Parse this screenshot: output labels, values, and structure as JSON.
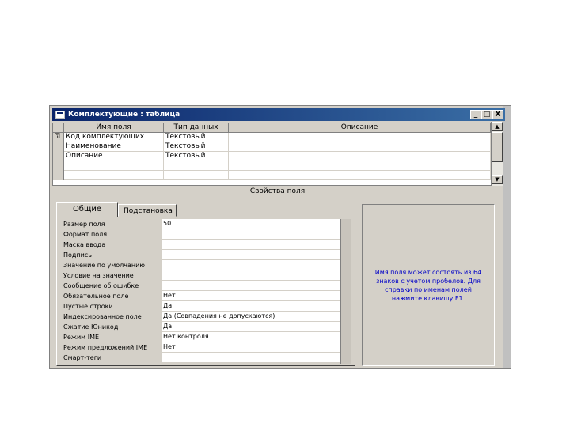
{
  "window": {
    "title": "Комплектующие : таблица",
    "controls": {
      "minimize": "_",
      "maximize": "□",
      "close": "X"
    }
  },
  "grid": {
    "columns": [
      "Имя поля",
      "Тип данных",
      "Описание"
    ],
    "rows": [
      {
        "name": "Код комплектующих",
        "type": "Текстовый",
        "desc": "",
        "key": true
      },
      {
        "name": "Наименование",
        "type": "Текстовый",
        "desc": ""
      },
      {
        "name": "Описание",
        "type": "Текстовый",
        "desc": ""
      },
      {
        "name": "",
        "type": "",
        "desc": ""
      },
      {
        "name": "",
        "type": "",
        "desc": ""
      }
    ]
  },
  "properties_title": "Свойства поля",
  "tabs": [
    "Общие",
    "Подстановка"
  ],
  "properties": [
    {
      "label": "Размер поля",
      "value": "50"
    },
    {
      "label": "Формат поля",
      "value": ""
    },
    {
      "label": "Маска ввода",
      "value": ""
    },
    {
      "label": "Подпись",
      "value": ""
    },
    {
      "label": "Значение по умолчанию",
      "value": ""
    },
    {
      "label": "Условие на значение",
      "value": ""
    },
    {
      "label": "Сообщение об ошибке",
      "value": ""
    },
    {
      "label": "Обязательное поле",
      "value": "Нет"
    },
    {
      "label": "Пустые строки",
      "value": "Да"
    },
    {
      "label": "Индексированное поле",
      "value": "Да (Совпадения не допускаются)"
    },
    {
      "label": "Сжатие Юникод",
      "value": "Да"
    },
    {
      "label": "Режим IME",
      "value": "Нет контроля"
    },
    {
      "label": "Режим предложений IME",
      "value": "Нет"
    },
    {
      "label": "Смарт-теги",
      "value": ""
    }
  ],
  "help_text": "Имя поля может состоять из 64 знаков с учетом пробелов. Для справки по именам полей нажмите клавишу F1.",
  "icons": {
    "key": "key-icon",
    "table": "table-icon"
  },
  "colors": {
    "titlebar_start": "#0a246a",
    "titlebar_end": "#3a6ea5",
    "help_text": "#0000c8",
    "chrome": "#d4d0c8"
  }
}
